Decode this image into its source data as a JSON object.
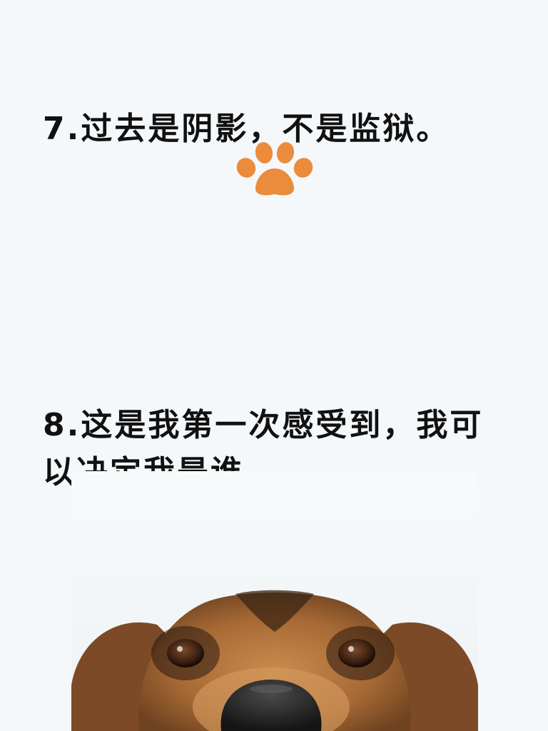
{
  "quotes": [
    {
      "number": "7.",
      "text": "过去是阴影，不是监狱。"
    },
    {
      "number": "8.",
      "text": "这是我第一次感受到，我可以决定我是谁。"
    }
  ],
  "decoration": {
    "icon": "paw-icon",
    "color": "#ea8c3c"
  },
  "photo": {
    "subject": "dog-face-photo"
  }
}
